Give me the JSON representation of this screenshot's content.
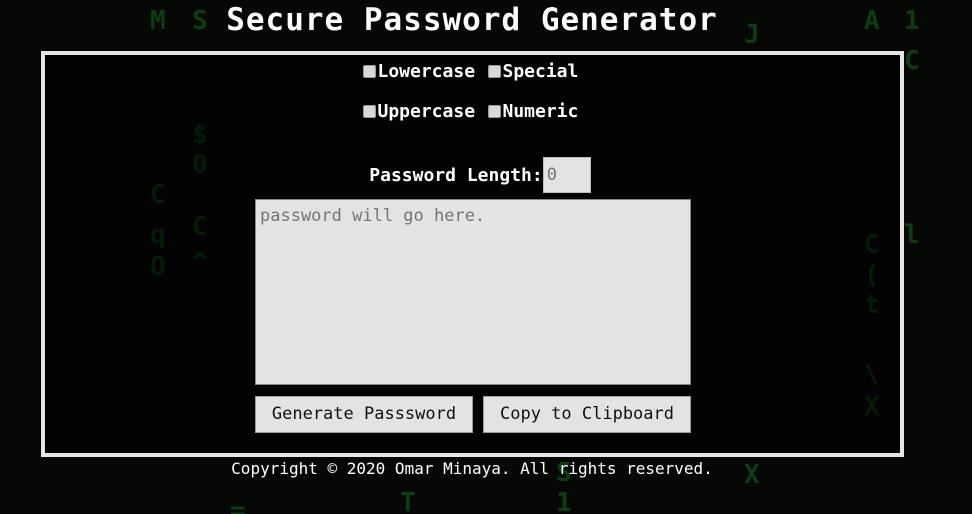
{
  "header": {
    "title": "Secure Password Generator"
  },
  "options": {
    "lowercase": {
      "label": "Lowercase"
    },
    "special": {
      "label": "Special"
    },
    "uppercase": {
      "label": "Uppercase"
    },
    "numeric": {
      "label": "Numeric"
    }
  },
  "length": {
    "label": "Password Length:",
    "placeholder": "0"
  },
  "output": {
    "placeholder": "password will go here."
  },
  "buttons": {
    "generate": "Generate Passsword",
    "copy": "Copy to Clipboard"
  },
  "footer": {
    "text": "Copyright © 2020 Omar Minaya. All rights reserved."
  },
  "colors": {
    "panel_border": "#e6e6e6",
    "field_bg": "#e3e3e3",
    "matrix_green": "#1f9a2a"
  }
}
